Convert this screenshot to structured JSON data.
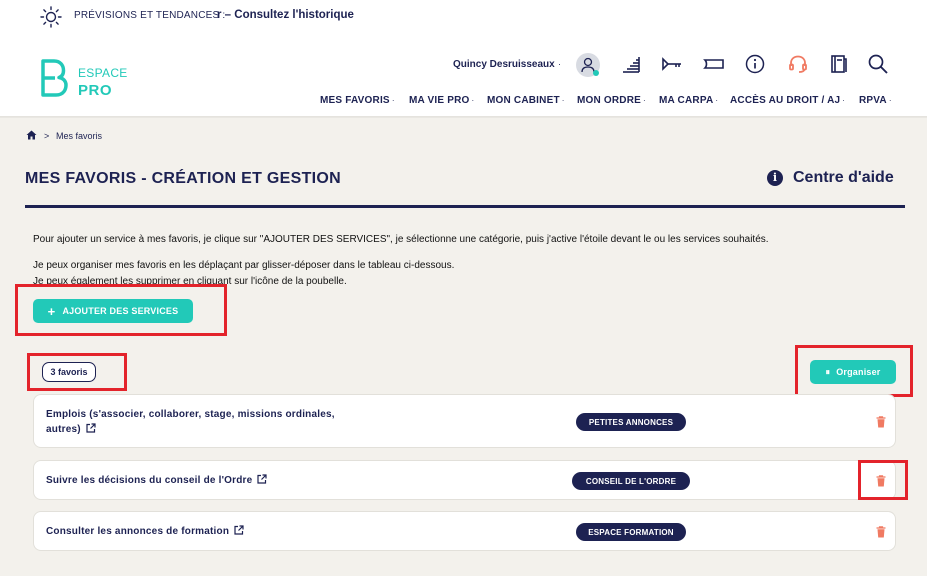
{
  "ticker": {
    "label": "PRÉVISIONS ET TENDANCES :",
    "link": "r – Consultez l'historique"
  },
  "logo": {
    "line1": "ESPACE",
    "line2": "PRO"
  },
  "user": {
    "name": "Quincy Desruisseaux",
    "caret": "·"
  },
  "nav": [
    {
      "label": "MES FAVORIS",
      "caret": "·"
    },
    {
      "label": "MA VIE PRO",
      "caret": "·"
    },
    {
      "label": "MON CABINET",
      "caret": "·"
    },
    {
      "label": "MON ORDRE",
      "caret": "·"
    },
    {
      "label": "MA CARPA",
      "caret": "·"
    },
    {
      "label": "ACCÈS AU DROIT / AJ",
      "caret": "·"
    },
    {
      "label": "RPVA",
      "caret": "·"
    }
  ],
  "breadcrumb": {
    "separator": ">",
    "current": "Mes favoris"
  },
  "page": {
    "title": "MES FAVORIS - CRÉATION ET GESTION",
    "help_label": "Centre d'aide",
    "help_icon_glyph": "i",
    "para1": "Pour ajouter un service à mes favoris, je clique sur \"AJOUTER DES SERVICES\", je sélectionne une catégorie, puis j'active l'étoile devant le ou les services souhaités.",
    "para2": "Je peux organiser mes favoris en les déplaçant par glisser-déposer dans le tableau ci-dessous.",
    "para3": "Je peux également les supprimer en cliquant sur l'icône de la poubelle.",
    "add_button": "AJOUTER DES SERVICES",
    "add_button_glyph": "+",
    "count_badge": "3 favoris",
    "organise_button": "Organiser",
    "organise_glyph": "⏸"
  },
  "favorites": [
    {
      "title_line1": "Emplois (s'associer, collaborer, stage, missions ordinales,",
      "title_line2": "autres)",
      "tag": "PETITES ANNONCES"
    },
    {
      "title_line1": "Suivre les décisions du conseil de l'Ordre",
      "tag": "CONSEIL DE L'ORDRE"
    },
    {
      "title_line1": "Consulter les annonces de formation",
      "tag": "ESPACE FORMATION"
    }
  ],
  "colors": {
    "navy": "#1d2252",
    "teal": "#22c9b8",
    "background": "#f3f1ec",
    "highlight_red": "#e3232b",
    "trash": "#f07a62",
    "headset": "#f07a62"
  },
  "icons": [
    "sun-icon",
    "user-avatar-icon",
    "stairs-icon",
    "key-icon",
    "ticket-icon",
    "info-icon",
    "headset-icon",
    "book-icon",
    "search-icon",
    "home-icon",
    "external-link-icon",
    "trash-icon"
  ]
}
